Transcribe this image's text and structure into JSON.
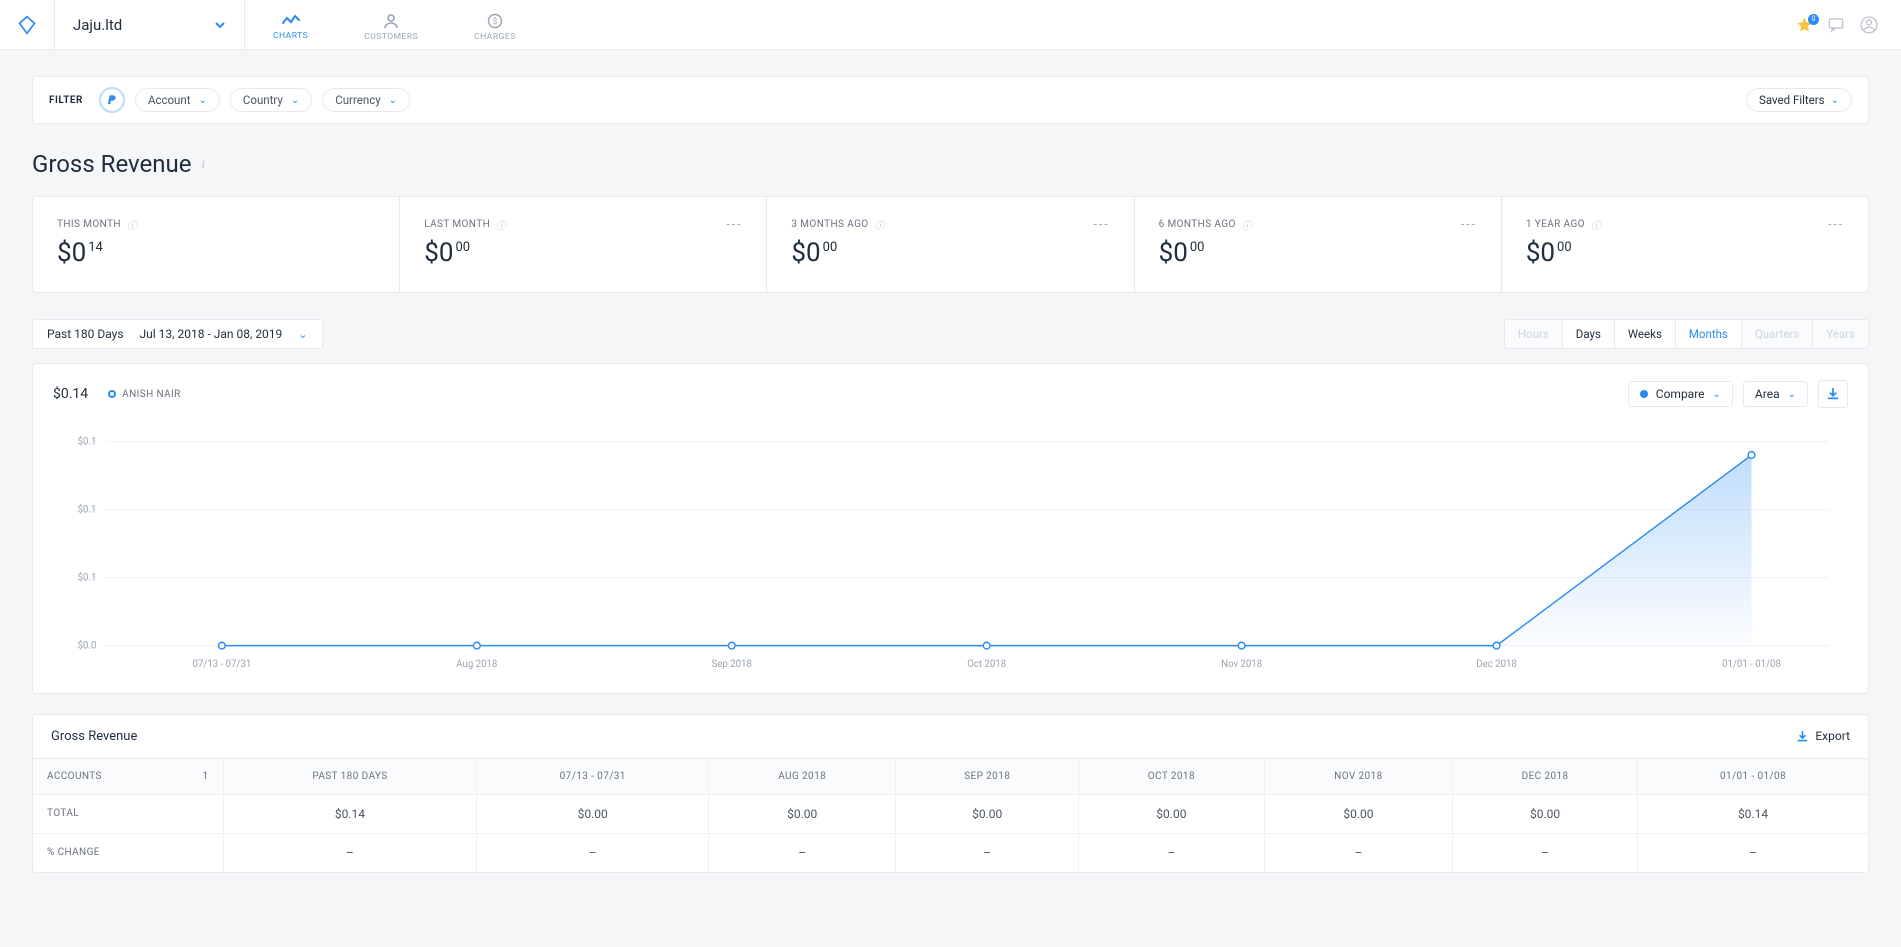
{
  "header": {
    "org": "Jaju.ltd",
    "nav": [
      {
        "label": "CHARTS",
        "active": true
      },
      {
        "label": "CUSTOMERS",
        "active": false
      },
      {
        "label": "CHARGES",
        "active": false
      }
    ],
    "star_badge": "0"
  },
  "filterbar": {
    "label": "FILTER",
    "chips": [
      "Account",
      "Country",
      "Currency"
    ],
    "saved": "Saved Filters"
  },
  "page": {
    "title": "Gross Revenue"
  },
  "stats": [
    {
      "label": "THIS MONTH",
      "currency": "$",
      "whole": "0",
      "cents": "14",
      "trend": ""
    },
    {
      "label": "LAST MONTH",
      "currency": "$",
      "whole": "0",
      "cents": "00",
      "trend": "---"
    },
    {
      "label": "3 MONTHS AGO",
      "currency": "$",
      "whole": "0",
      "cents": "00",
      "trend": "---"
    },
    {
      "label": "6 MONTHS AGO",
      "currency": "$",
      "whole": "0",
      "cents": "00",
      "trend": "---"
    },
    {
      "label": "1 YEAR AGO",
      "currency": "$",
      "whole": "0",
      "cents": "00",
      "trend": "---"
    }
  ],
  "range": {
    "preset": "Past 180 Days",
    "dates": "Jul 13, 2018 - Jan 08, 2019"
  },
  "granularity": [
    {
      "label": "Hours",
      "state": "disabled"
    },
    {
      "label": "Days",
      "state": "normal"
    },
    {
      "label": "Weeks",
      "state": "normal"
    },
    {
      "label": "Months",
      "state": "active"
    },
    {
      "label": "Quarters",
      "state": "disabled"
    },
    {
      "label": "Years",
      "state": "disabled"
    }
  ],
  "chart": {
    "total": "$0.14",
    "legend": "ANISH NAIR",
    "compare_label": "Compare",
    "type_label": "Area"
  },
  "chart_data": {
    "type": "area",
    "categories": [
      "07/13 - 07/31",
      "Aug 2018",
      "Sep 2018",
      "Oct 2018",
      "Nov 2018",
      "Dec 2018",
      "01/01 - 01/08"
    ],
    "series": [
      {
        "name": "ANISH NAIR",
        "values": [
          0.0,
          0.0,
          0.0,
          0.0,
          0.0,
          0.0,
          0.14
        ]
      }
    ],
    "yticks": [
      "$0.0",
      "$0.1",
      "$0.1",
      "$0.1"
    ],
    "ylim": [
      0,
      0.15
    ]
  },
  "table": {
    "title": "Gross Revenue",
    "export": "Export",
    "columns": [
      "ACCOUNTS",
      "PAST 180 DAYS",
      "07/13 - 07/31",
      "AUG 2018",
      "SEP 2018",
      "OCT 2018",
      "NOV 2018",
      "DEC 2018",
      "01/01 - 01/08"
    ],
    "accounts_count": "1",
    "rows": [
      {
        "label": "TOTAL",
        "cells": [
          "$0.14",
          "$0.00",
          "$0.00",
          "$0.00",
          "$0.00",
          "$0.00",
          "$0.00",
          "$0.14"
        ]
      },
      {
        "label": "% CHANGE",
        "cells": [
          "–",
          "–",
          "–",
          "–",
          "–",
          "–",
          "–",
          "–"
        ]
      }
    ]
  }
}
